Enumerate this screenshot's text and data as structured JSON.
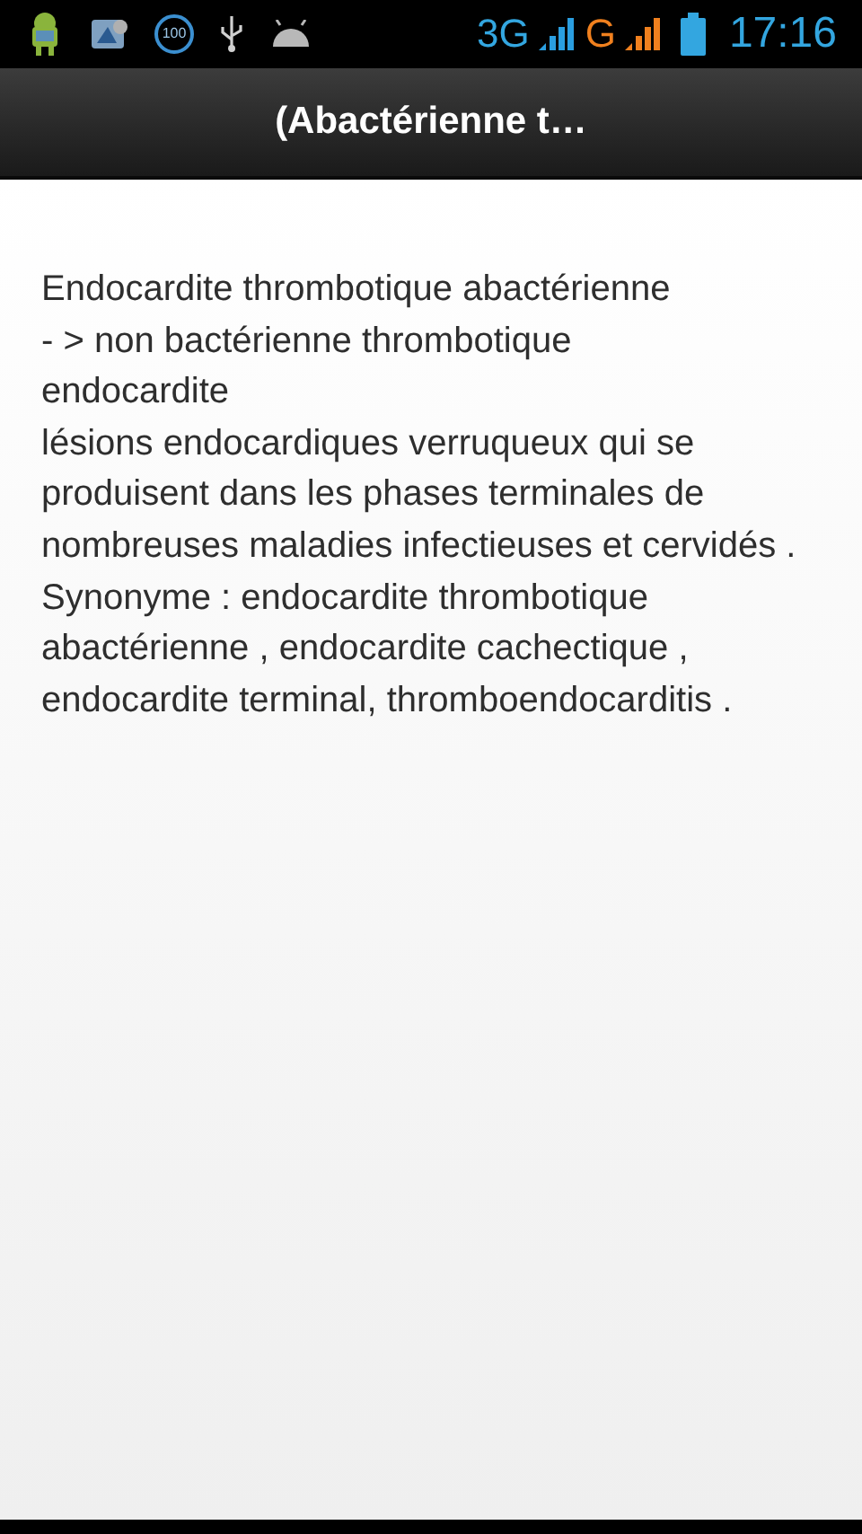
{
  "status_bar": {
    "notification_badge": "100",
    "network_primary": "3G",
    "network_secondary": "G",
    "time": "17:16"
  },
  "title_bar": {
    "title": "(Abactérienne t…"
  },
  "content": {
    "paragraphs": [
      "Endocardite thrombotique abactérienne\n- > non bactérienne thrombotique\nendocardite",
      "lésions endocardiques verruqueux qui se produisent dans les phases terminales de nombreuses maladies infectieuses et cervidés .",
      "Synonyme : endocardite thrombotique abactérienne , endocardite cachectique , endocardite terminal, thromboendocarditis ."
    ]
  }
}
